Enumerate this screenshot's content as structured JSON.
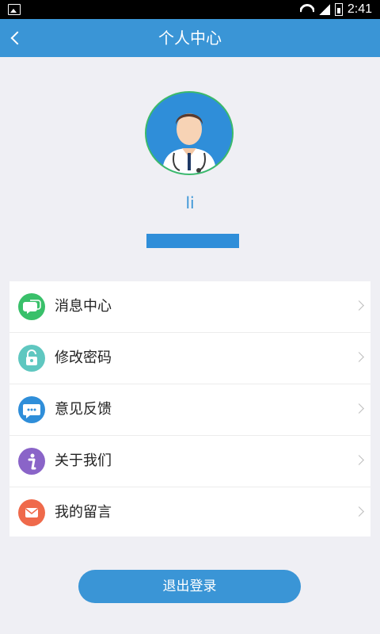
{
  "status_bar": {
    "time": "2:41"
  },
  "navbar": {
    "title": "个人中心"
  },
  "profile": {
    "username": "li"
  },
  "menu": {
    "items": [
      {
        "label": "消息中心",
        "icon": "chat-bubbles-icon",
        "icon_color": "#39c06a"
      },
      {
        "label": "修改密码",
        "icon": "unlock-icon",
        "icon_color": "#5fc7c0"
      },
      {
        "label": "意见反馈",
        "icon": "speech-bubble-icon",
        "icon_color": "#2f8ed9"
      },
      {
        "label": "关于我们",
        "icon": "info-icon",
        "icon_color": "#8a64c8"
      },
      {
        "label": "我的留言",
        "icon": "envelope-icon",
        "icon_color": "#ef6a4b"
      }
    ]
  },
  "footer": {
    "logout_label": "退出登录"
  },
  "colors": {
    "primary": "#3a95d6",
    "background": "#efeff4"
  }
}
